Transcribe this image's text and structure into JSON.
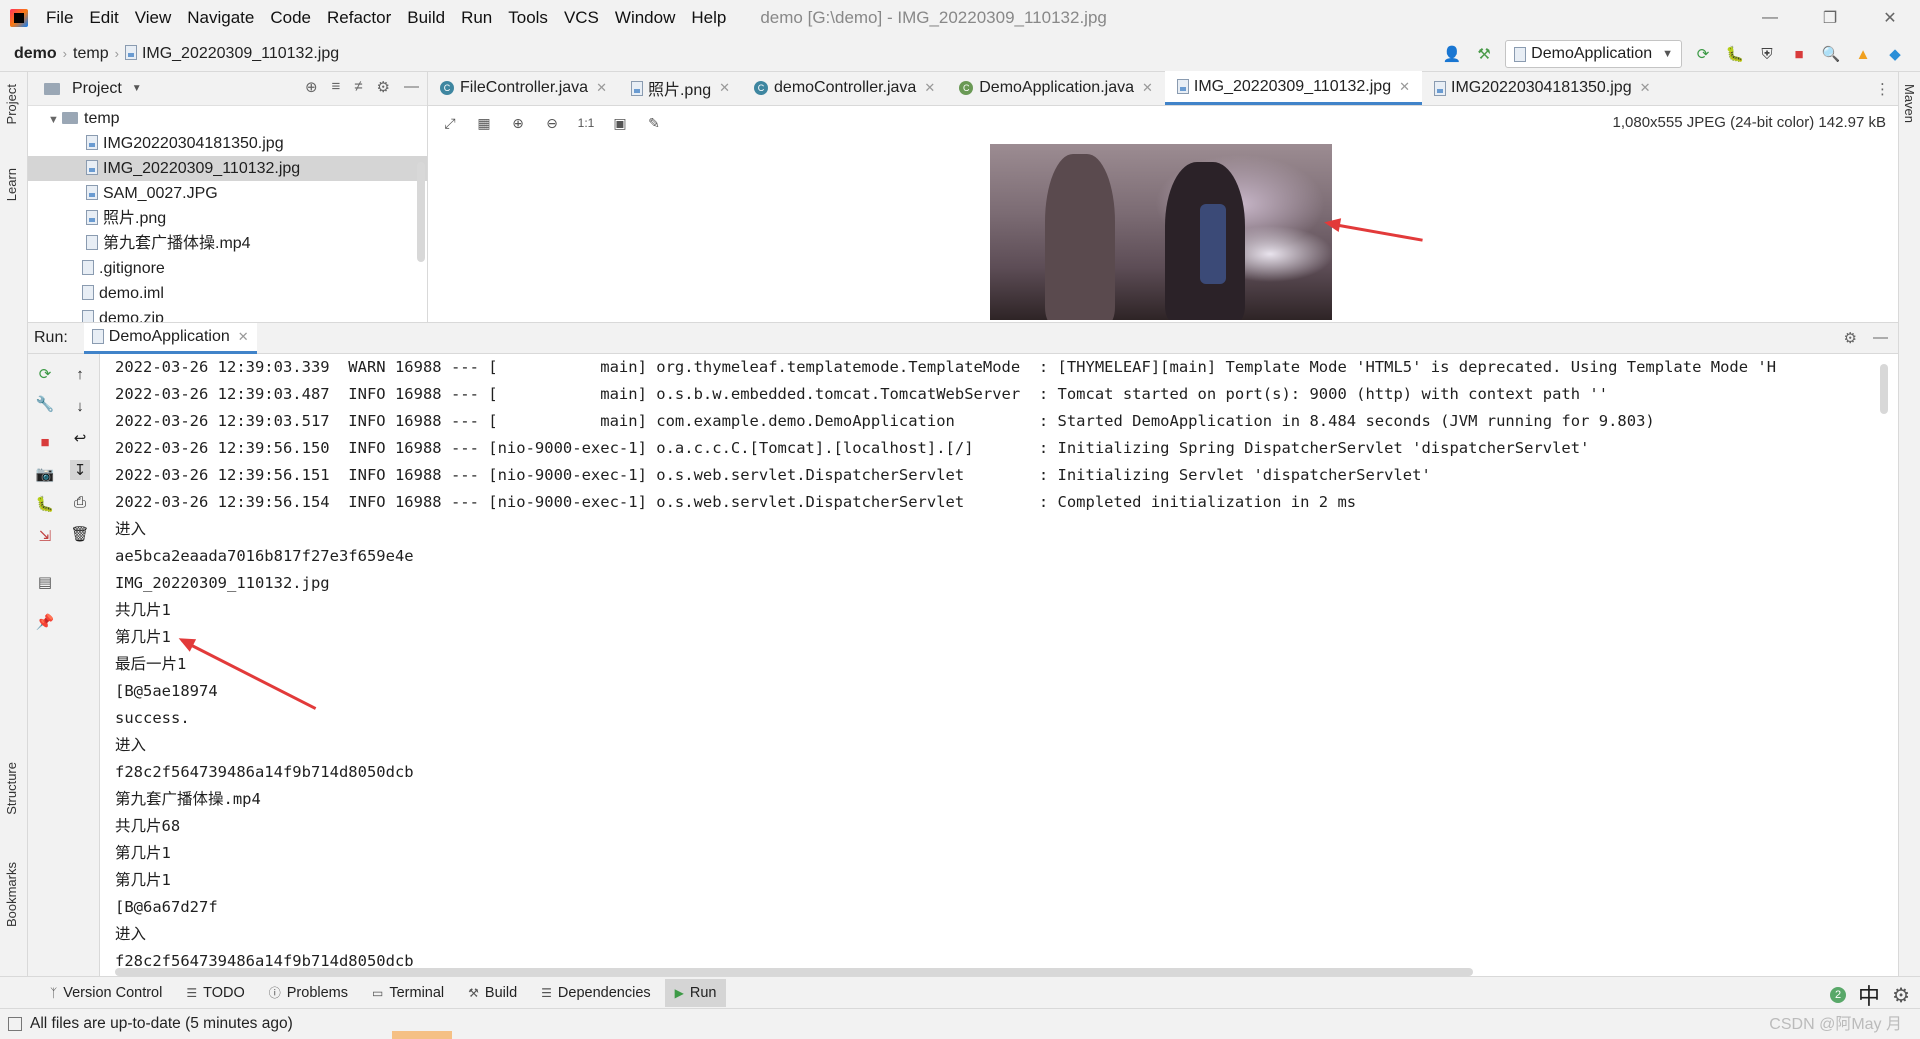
{
  "menubar": {
    "items": [
      "File",
      "Edit",
      "View",
      "Navigate",
      "Code",
      "Refactor",
      "Build",
      "Run",
      "Tools",
      "VCS",
      "Window",
      "Help"
    ],
    "window_title": "demo [G:\\demo] - IMG_20220309_110132.jpg"
  },
  "navbar": {
    "breadcrumbs": [
      "demo",
      "temp",
      "IMG_20220309_110132.jpg"
    ],
    "run_config": "DemoApplication"
  },
  "left_stripe": {
    "tabs": [
      "Project",
      "Learn",
      "Structure",
      "Bookmarks"
    ]
  },
  "right_stripe": {
    "tabs": [
      "Maven"
    ]
  },
  "project_panel": {
    "title": "Project",
    "tree": [
      {
        "label": "temp",
        "type": "folder"
      },
      {
        "label": "IMG20220304181350.jpg",
        "type": "image"
      },
      {
        "label": "IMG_20220309_110132.jpg",
        "type": "image",
        "selected": true
      },
      {
        "label": "SAM_0027.JPG",
        "type": "image"
      },
      {
        "label": "照片.png",
        "type": "image"
      },
      {
        "label": "第九套广播体操.mp4",
        "type": "file"
      },
      {
        "label": ".gitignore",
        "type": "file"
      },
      {
        "label": "demo.iml",
        "type": "file"
      },
      {
        "label": "demo.zip",
        "type": "file"
      }
    ]
  },
  "editor": {
    "tabs": [
      {
        "label": "FileController.java",
        "icon": "class-icon"
      },
      {
        "label": "照片.png",
        "icon": "image-icon"
      },
      {
        "label": "demoController.java",
        "icon": "class-icon"
      },
      {
        "label": "DemoApplication.java",
        "icon": "spring-class-icon"
      },
      {
        "label": "IMG_20220309_110132.jpg",
        "icon": "image-icon",
        "active": true
      },
      {
        "label": "IMG20220304181350.jpg",
        "icon": "image-icon"
      }
    ],
    "image_info": "1,080x555 JPEG (24-bit color) 142.97 kB",
    "zoom_label": "1:1"
  },
  "run_panel": {
    "label": "Run:",
    "tab": "DemoApplication",
    "lines": [
      "2022-03-26 12:39:03.339  WARN 16988 --- [           main] org.thymeleaf.templatemode.TemplateMode  : [THYMELEAF][main] Template Mode 'HTML5' is deprecated. Using Template Mode 'H",
      "2022-03-26 12:39:03.487  INFO 16988 --- [           main] o.s.b.w.embedded.tomcat.TomcatWebServer  : Tomcat started on port(s): 9000 (http) with context path ''",
      "2022-03-26 12:39:03.517  INFO 16988 --- [           main] com.example.demo.DemoApplication         : Started DemoApplication in 8.484 seconds (JVM running for 9.803)",
      "2022-03-26 12:39:56.150  INFO 16988 --- [nio-9000-exec-1] o.a.c.c.C.[Tomcat].[localhost].[/]       : Initializing Spring DispatcherServlet 'dispatcherServlet'",
      "2022-03-26 12:39:56.151  INFO 16988 --- [nio-9000-exec-1] o.s.web.servlet.DispatcherServlet        : Initializing Servlet 'dispatcherServlet'",
      "2022-03-26 12:39:56.154  INFO 16988 --- [nio-9000-exec-1] o.s.web.servlet.DispatcherServlet        : Completed initialization in 2 ms",
      "进入",
      "ae5bca2eaada7016b817f27e3f659e4e",
      "IMG_20220309_110132.jpg",
      "共几片1",
      "第几片1",
      "最后一片1",
      "[B@5ae18974",
      "success.",
      "进入",
      "f28c2f564739486a14f9b714d8050dcb",
      "第九套广播体操.mp4",
      "共几片68",
      "第几片1",
      "第几片1",
      "[B@6a67d27f",
      "进入",
      "f28c2f564739486a14f9b714d8050dcb"
    ]
  },
  "bottom_tabs": [
    "Version Control",
    "TODO",
    "Problems",
    "Terminal",
    "Build",
    "Dependencies",
    "Run"
  ],
  "bottom_right": {
    "badge": "2",
    "ime": "中"
  },
  "statusbar": {
    "text": "All files are up-to-date (5 minutes ago)"
  },
  "watermark": "CSDN @阿May 月",
  "colors": {
    "accent": "#4083c9",
    "annotation": "#e23a3a",
    "selection": "#d5d5d5"
  }
}
